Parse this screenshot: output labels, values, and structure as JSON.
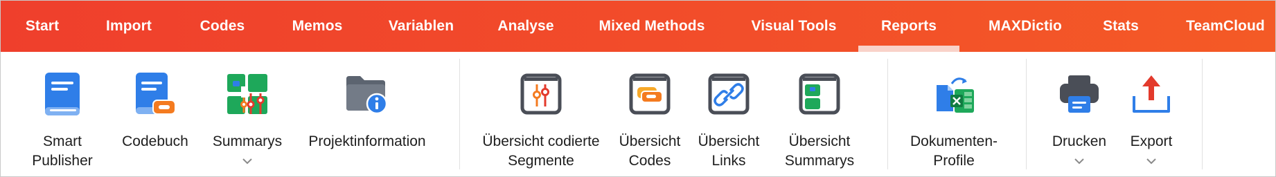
{
  "tabs": [
    {
      "label": "Start"
    },
    {
      "label": "Import"
    },
    {
      "label": "Codes"
    },
    {
      "label": "Memos"
    },
    {
      "label": "Variablen"
    },
    {
      "label": "Analyse"
    },
    {
      "label": "Mixed Methods"
    },
    {
      "label": "Visual Tools"
    },
    {
      "label": "Reports",
      "active": true
    },
    {
      "label": "MAXDictio"
    },
    {
      "label": "Stats"
    },
    {
      "label": "TeamCloud"
    }
  ],
  "ribbon": {
    "smart_publisher": {
      "line1": "Smart",
      "line2": "Publisher",
      "icon": "book-icon"
    },
    "codebuch": {
      "line1": "Codebuch",
      "icon": "codebook-icon"
    },
    "summarys": {
      "line1": "Summarys",
      "icon": "summary-grid-icon",
      "has_dropdown": true
    },
    "projektinformation": {
      "line1": "Projektinformation",
      "icon": "folder-info-icon"
    },
    "uebersicht_segmente": {
      "line1": "Übersicht codierte",
      "line2": "Segmente",
      "icon": "coded-segments-icon"
    },
    "uebersicht_codes": {
      "line1": "Übersicht",
      "line2": "Codes",
      "icon": "codes-overview-icon"
    },
    "uebersicht_links": {
      "line1": "Übersicht",
      "line2": "Links",
      "icon": "link-icon"
    },
    "uebersicht_summarys": {
      "line1": "Übersicht",
      "line2": "Summarys",
      "icon": "summarys-overview-icon"
    },
    "dokumenten_profile": {
      "line1": "Dokumenten-",
      "line2": "Profile",
      "icon": "document-profile-icon"
    },
    "drucken": {
      "line1": "Drucken",
      "icon": "printer-icon",
      "has_dropdown": true
    },
    "export": {
      "line1": "Export",
      "icon": "export-icon",
      "has_dropdown": true
    }
  },
  "colors": {
    "tabbar": "#ef3f2c",
    "active_tab_underline": "#f9d2c9",
    "blue": "#2f7ee8",
    "orange": "#f47b20",
    "green": "#1ea85a",
    "red": "#e33a2c",
    "dark": "#4a4e57"
  }
}
